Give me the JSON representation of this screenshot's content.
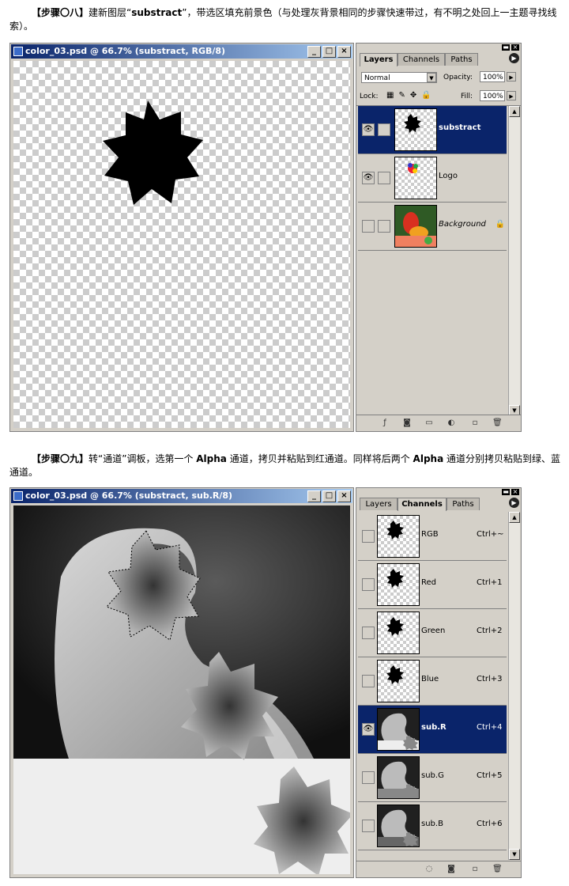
{
  "step8": {
    "heading": "【步骤〇八】",
    "text_a": "建新图层“",
    "layer_name": "substract",
    "text_b": "”，带选区填充前景色（与处理灰背景相同的步骤快速带过，有不明之处回上一主题寻找线索）。"
  },
  "window1": {
    "title": "color_03.psd @ 66.7% (substract, RGB/8)",
    "buttons": [
      "_",
      "□",
      "×"
    ]
  },
  "layers_panel": {
    "tabs": [
      "Layers",
      "Channels",
      "Paths"
    ],
    "blend_mode": "Normal",
    "opacity_label": "Opacity:",
    "opacity_value": "100%",
    "lock_label": "Lock:",
    "fill_label": "Fill:",
    "fill_value": "100%",
    "layers": [
      {
        "name": "substract",
        "selected": true,
        "visible": true
      },
      {
        "name": "Logo",
        "selected": false,
        "visible": true
      },
      {
        "name": "Background",
        "selected": false,
        "visible": false
      }
    ]
  },
  "step9": {
    "heading": "【步骤〇九】",
    "text_a": "转“通道”调板，选第一个 ",
    "alpha1": "Alpha",
    "text_b": " 通道，拷贝并粘贴到红通道。同样将后两个 ",
    "alpha2": "Alpha",
    "text_c": " 通道分别拷贝粘贴到绿、蓝通道。"
  },
  "window2": {
    "title": "color_03.psd @ 66.7% (substract, sub.R/8)",
    "buttons": [
      "_",
      "□",
      "×"
    ]
  },
  "channels_panel": {
    "tabs": [
      "Layers",
      "Channels",
      "Paths"
    ],
    "channels": [
      {
        "name": "RGB",
        "shortcut": "Ctrl+~",
        "selected": false,
        "visible": false
      },
      {
        "name": "Red",
        "shortcut": "Ctrl+1",
        "selected": false,
        "visible": false
      },
      {
        "name": "Green",
        "shortcut": "Ctrl+2",
        "selected": false,
        "visible": false
      },
      {
        "name": "Blue",
        "shortcut": "Ctrl+3",
        "selected": false,
        "visible": false
      },
      {
        "name": "sub.R",
        "shortcut": "Ctrl+4",
        "selected": true,
        "visible": true
      },
      {
        "name": "sub.G",
        "shortcut": "Ctrl+5",
        "selected": false,
        "visible": false
      },
      {
        "name": "sub.B",
        "shortcut": "Ctrl+6",
        "selected": false,
        "visible": false
      }
    ]
  },
  "colors": {
    "selection_blue": "#0a246a",
    "panel_gray": "#d4d0c8"
  }
}
